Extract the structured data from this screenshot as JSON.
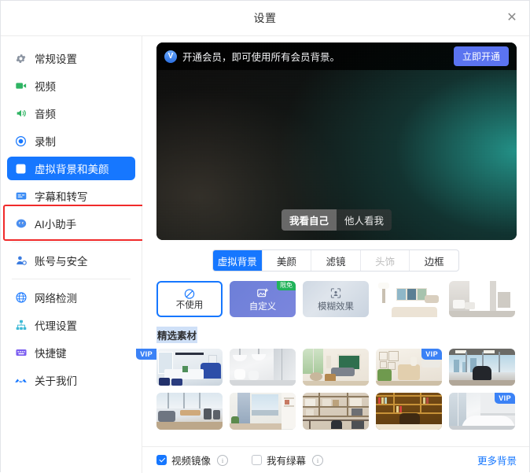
{
  "window": {
    "title": "设置",
    "close_label": "✕"
  },
  "sidebar": {
    "items": [
      {
        "label": "常规设置",
        "icon": "gear-icon",
        "color": "#8a93a0",
        "active": false
      },
      {
        "label": "视频",
        "icon": "video-camera-icon",
        "color": "#2fb463",
        "active": false
      },
      {
        "label": "音频",
        "icon": "speaker-icon",
        "color": "#2fb463",
        "active": false
      },
      {
        "label": "录制",
        "icon": "record-icon",
        "color": "#1677ff",
        "active": false
      },
      {
        "label": "虚拟背景和美颜",
        "icon": "person-card-icon",
        "color": "#1677ff",
        "active": true
      },
      {
        "label": "字幕和转写",
        "icon": "caption-icon",
        "color": "#1677ff",
        "active": false
      },
      {
        "label": "AI小助手",
        "icon": "ai-assistant-icon",
        "color": "#3b7ce0",
        "active": false
      },
      {
        "label": "账号与安全",
        "icon": "user-shield-icon",
        "color": "#3b7ce0",
        "active": false
      },
      {
        "label": "网络检测",
        "icon": "globe-icon",
        "color": "#1677ff",
        "active": false
      },
      {
        "label": "代理设置",
        "icon": "proxy-node-icon",
        "color": "#3ebad6",
        "active": false
      },
      {
        "label": "快捷键",
        "icon": "keyboard-icon",
        "color": "#7a5cf0",
        "active": false
      },
      {
        "label": "关于我们",
        "icon": "logo-icon",
        "color": "#1677ff",
        "active": false
      }
    ],
    "highlight_color": "#f02a2a"
  },
  "promo": {
    "badge": "V",
    "text": "开通会员，即可使用所有会员背景。",
    "button": "立即开通"
  },
  "preview": {
    "view_self": "我看自己",
    "view_others": "他人看我",
    "selected": "我看自己"
  },
  "tabs": [
    {
      "label": "虚拟背景",
      "state": "active"
    },
    {
      "label": "美颜",
      "state": "normal"
    },
    {
      "label": "滤镜",
      "state": "normal"
    },
    {
      "label": "头饰",
      "state": "disabled"
    },
    {
      "label": "边框",
      "state": "normal"
    }
  ],
  "effects": [
    {
      "label": "不使用",
      "type": "none",
      "selected": true,
      "badge": ""
    },
    {
      "label": "自定义",
      "type": "custom",
      "selected": false,
      "badge": "限免"
    },
    {
      "label": "模糊效果",
      "type": "blur",
      "selected": false,
      "badge": ""
    },
    {
      "label": "",
      "type": "image-livingroom-lamp",
      "selected": false,
      "badge": ""
    },
    {
      "label": "",
      "type": "image-bedroom-white",
      "selected": false,
      "badge": ""
    }
  ],
  "section": {
    "title": "精选素材"
  },
  "gallery": {
    "rows": [
      [
        {
          "name": "meeting-room-blue-chairs",
          "badge": ""
        },
        {
          "name": "white-dining-pendant-lights",
          "badge": ""
        },
        {
          "name": "living-room-green-window",
          "badge": ""
        },
        {
          "name": "living-room-green-sofa",
          "badge": "VIP"
        },
        {
          "name": "office-city-window-chair",
          "badge": "VIP"
        }
      ],
      [
        {
          "name": "modern-open-office",
          "badge": ""
        },
        {
          "name": "bedroom-curtain-window",
          "badge": ""
        },
        {
          "name": "study-bookshelf-desk",
          "badge": ""
        },
        {
          "name": "wooden-library-office",
          "badge": ""
        },
        {
          "name": "white-meeting-table",
          "badge": "VIP"
        }
      ]
    ]
  },
  "bottom": {
    "mirror_label": "视频镜像",
    "mirror_checked": true,
    "greenscreen_label": "我有绿幕",
    "greenscreen_checked": false,
    "more_link": "更多背景"
  },
  "colors": {
    "accent": "#1677ff",
    "vip": "#3b82f6",
    "free": "#21b35a",
    "highlight": "#f02a2a"
  }
}
